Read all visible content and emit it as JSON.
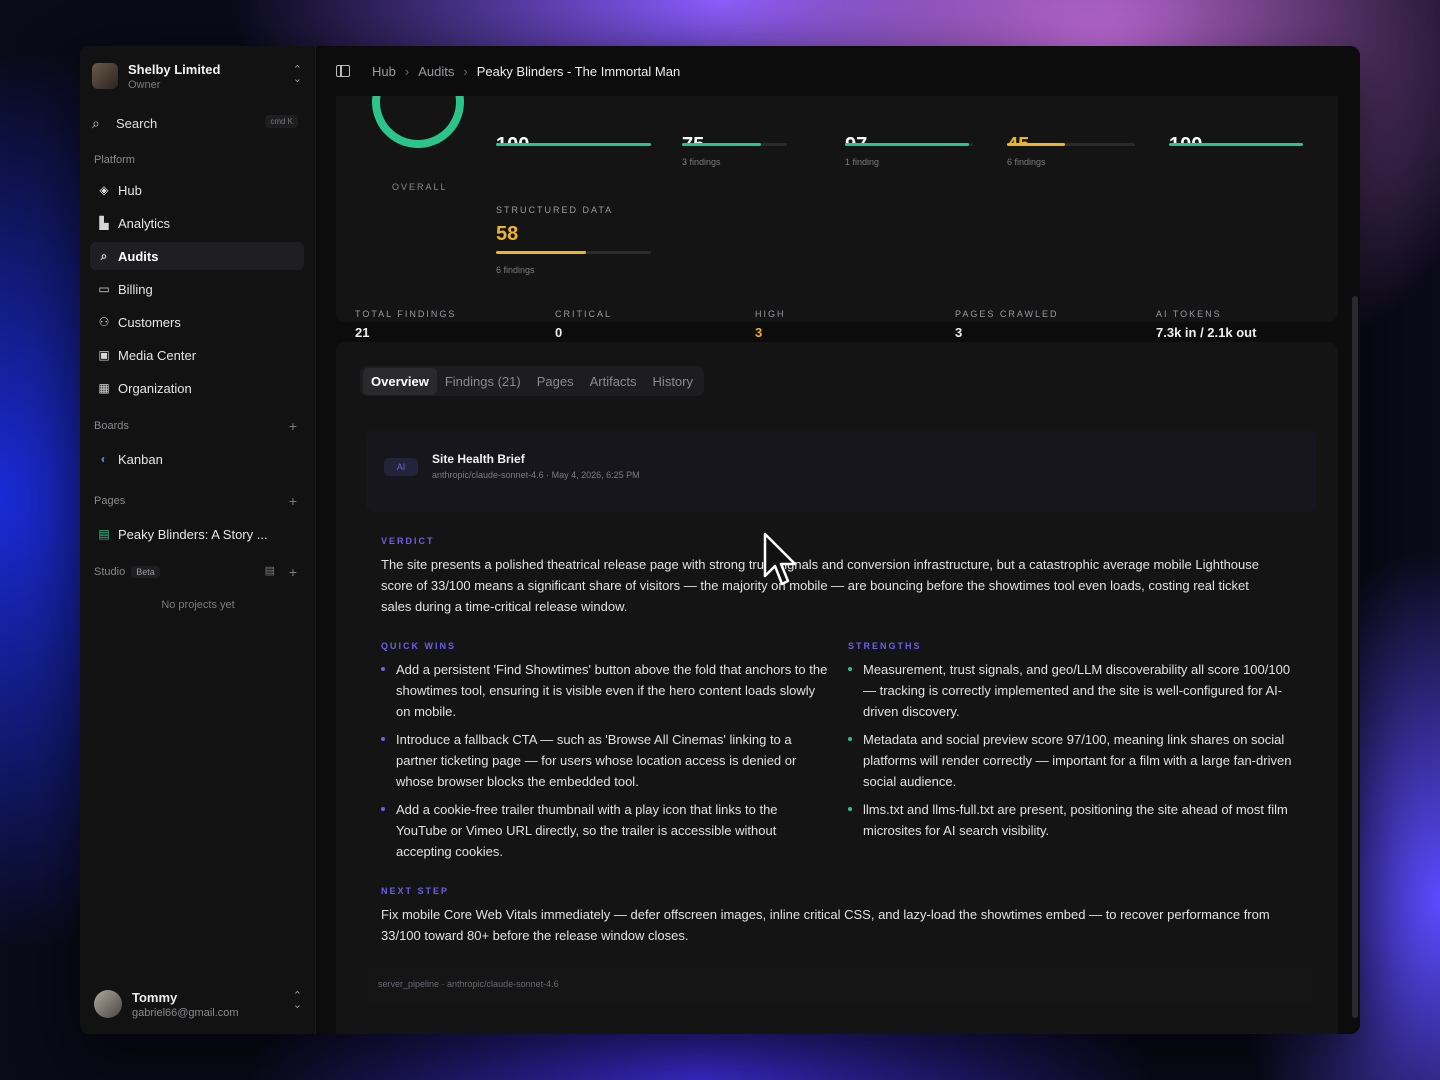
{
  "workspace": {
    "name": "Shelby Limited",
    "role": "Owner"
  },
  "search": {
    "label": "Search",
    "shortcut": "cmd K"
  },
  "sidebar": {
    "platform_label": "Platform",
    "items": [
      {
        "label": "Hub",
        "icon": "layers-icon"
      },
      {
        "label": "Analytics",
        "icon": "bar-chart-icon"
      },
      {
        "label": "Audits",
        "icon": "search-audit-icon"
      },
      {
        "label": "Billing",
        "icon": "credit-card-icon"
      },
      {
        "label": "Customers",
        "icon": "users-icon"
      },
      {
        "label": "Media Center",
        "icon": "media-icon"
      },
      {
        "label": "Organization",
        "icon": "building-icon"
      }
    ],
    "boards_label": "Boards",
    "boards": [
      {
        "label": "Kanban"
      }
    ],
    "pages_label": "Pages",
    "pages": [
      {
        "label": "Peaky Blinders: A Story ..."
      }
    ],
    "studio_label": "Studio",
    "studio_badge": "Beta",
    "studio_empty": "No projects yet"
  },
  "user": {
    "name": "Tommy",
    "email": "gabriel66@gmail.com"
  },
  "breadcrumb": [
    "Hub",
    "Audits",
    "Peaky Blinders - The Immortal Man"
  ],
  "scores": {
    "overall_label": "OVERALL",
    "top": [
      {
        "value": "100",
        "sub": "",
        "pct": 100,
        "color": "#2bc48a"
      },
      {
        "value": "75",
        "sub": "3 findings",
        "pct": 75,
        "color": "#2bc48a"
      },
      {
        "value": "97",
        "sub": "1 finding",
        "pct": 97,
        "color": "#2bc48a"
      },
      {
        "value": "45",
        "sub": "6 findings",
        "pct": 45,
        "color": "#f0b429"
      },
      {
        "value": "100",
        "sub": "",
        "pct": 100,
        "color": "#2bc48a"
      }
    ],
    "structured_label": "STRUCTURED DATA",
    "structured_value": "58",
    "structured_pct": 58,
    "structured_sub": "6 findings"
  },
  "stats": [
    {
      "label": "TOTAL FINDINGS",
      "value": "21"
    },
    {
      "label": "CRITICAL",
      "value": "0"
    },
    {
      "label": "HIGH",
      "value": "3"
    },
    {
      "label": "PAGES CRAWLED",
      "value": "3"
    },
    {
      "label": "AI TOKENS",
      "value": "7.3k in / 2.1k out"
    }
  ],
  "tabs": [
    "Overview",
    "Findings (21)",
    "Pages",
    "Artifacts",
    "History"
  ],
  "brief": {
    "chip": "AI",
    "title": "Site Health Brief",
    "meta": "anthropic/claude-sonnet-4.6 · May 4, 2026, 6:25 PM"
  },
  "verdict": {
    "heading": "VERDICT",
    "text": "The site presents a polished theatrical release page with strong trust signals and conversion infrastructure, but a catastrophic average mobile Lighthouse score of 33/100 means a significant share of visitors — the majority on mobile — are bouncing before the showtimes tool even loads, costing real ticket sales during a time-critical release window."
  },
  "quick_wins": {
    "heading": "QUICK WINS",
    "items": [
      "Add a persistent 'Find Showtimes' button above the fold that anchors to the showtimes tool, ensuring it is visible even if the hero content loads slowly on mobile.",
      "Introduce a fallback CTA — such as 'Browse All Cinemas' linking to a partner ticketing page — for users whose location access is denied or whose browser blocks the embedded tool.",
      "Add a cookie-free trailer thumbnail with a play icon that links to the YouTube or Vimeo URL directly, so the trailer is accessible without accepting cookies."
    ]
  },
  "strengths": {
    "heading": "STRENGTHS",
    "items": [
      "Measurement, trust signals, and geo/LLM discoverability all score 100/100 — tracking is correctly implemented and the site is well-configured for AI-driven discovery.",
      "Metadata and social preview score 97/100, meaning link shares on social platforms will render correctly — important for a film with a large fan-driven social audience.",
      "llms.txt and llms-full.txt are present, positioning the site ahead of most film microsites for AI search visibility."
    ]
  },
  "next_step": {
    "heading": "NEXT STEP",
    "text": "Fix mobile Core Web Vitals immediately — defer offscreen images, inline critical CSS, and lazy-load the showtimes embed — to recover performance from 33/100 toward 80+ before the release window closes."
  },
  "footer": "server_pipeline · anthropic/claude-sonnet-4.6"
}
